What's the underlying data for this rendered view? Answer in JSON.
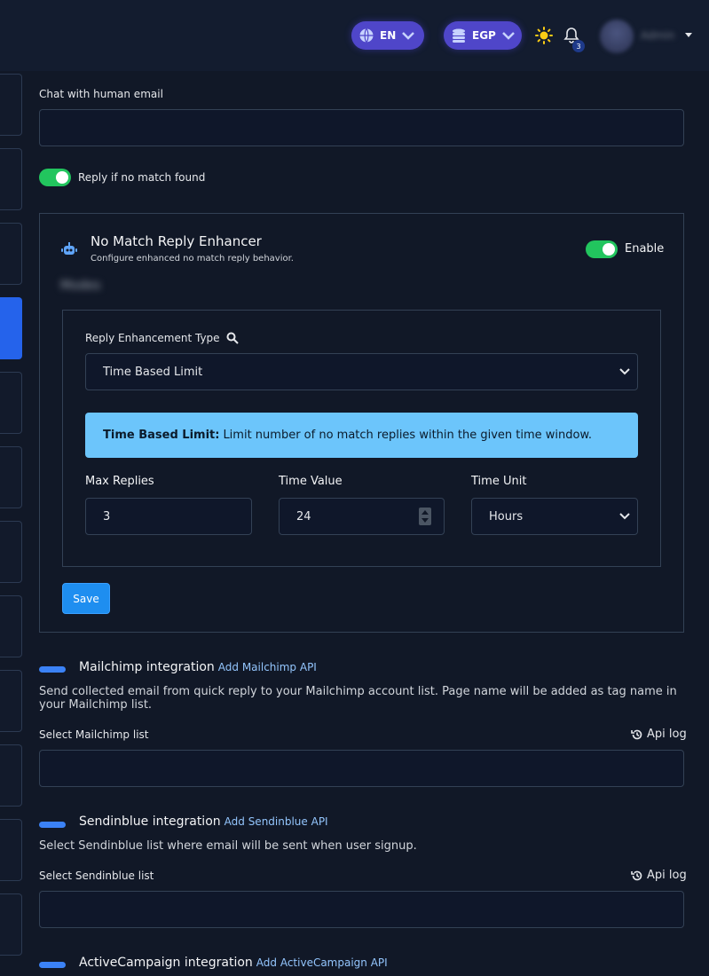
{
  "navbar": {
    "language": "EN",
    "currency": "EGP",
    "notification_count": "3",
    "username": "Admin"
  },
  "chat_human_email": {
    "label": "Chat with human email",
    "value": ""
  },
  "reply_no_match": {
    "label": "Reply if no match found",
    "enabled": true
  },
  "enhancer": {
    "title": "No Match Reply Enhancer",
    "subtitle": "Configure enhanced no match reply behavior.",
    "toggle_label": "Enable",
    "enabled": true,
    "blurred_text": "Modes",
    "type_label": "Reply Enhancement Type",
    "type_value": "Time Based Limit",
    "alert_title": "Time Based Limit:",
    "alert_text": "Limit number of no match replies within the given time window.",
    "max_replies_label": "Max Replies",
    "max_replies_value": "3",
    "time_value_label": "Time Value",
    "time_value_value": "24",
    "time_unit_label": "Time Unit",
    "time_unit_value": "Hours",
    "save_label": "Save"
  },
  "mailchimp": {
    "title": "Mailchimp integration",
    "add_link": "Add Mailchimp API",
    "description": "Send collected email from quick reply to your Mailchimp account list. Page name will be added as tag name in your Mailchimp list.",
    "select_label": "Select Mailchimp list",
    "api_log": "Api log"
  },
  "sendinblue": {
    "title": "Sendinblue integration",
    "add_link": "Add Sendinblue API",
    "description": "Select Sendinblue list where email will be sent when user signup.",
    "select_label": "Select Sendinblue list",
    "api_log": "Api log"
  },
  "activecampaign": {
    "title": "ActiveCampaign integration",
    "add_link": "Add ActiveCampaign API"
  },
  "colors": {
    "background": "#111827",
    "accent": "#4f46c9",
    "toggle_on": "#22c55e",
    "alert_bg": "#6cc5fb",
    "primary_button": "#1e8ef0"
  }
}
